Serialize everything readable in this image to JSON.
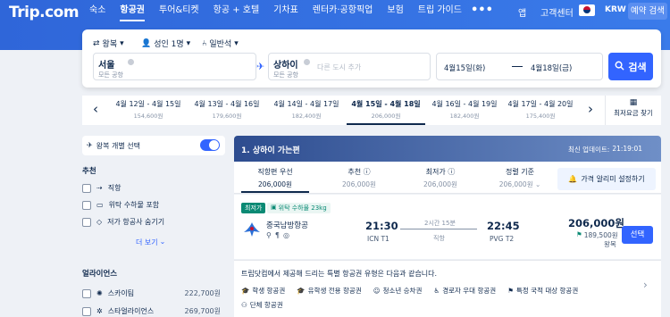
{
  "header": {
    "logo": "Trip.com",
    "nav": [
      "숙소",
      "항공권",
      "투어&티켓",
      "항공 + 호텔",
      "기차표",
      "렌터카·공항픽업",
      "보험",
      "트립 가이드"
    ],
    "more": "•••",
    "app": "앱",
    "support": "고객센터",
    "currency": "KRW",
    "check_booking": "예약 검색"
  },
  "search": {
    "trip_type": "왕복",
    "passengers": "성인 1명",
    "cabin": "일반석",
    "from_city": "서울",
    "from_sub": "모든 공항",
    "to_city": "상하이",
    "to_sub": "모든 공항",
    "add_city_placeholder": "다른 도시 추가",
    "depart_date": "4월15일(화)",
    "return_date": "4월18일(금)",
    "search_label": "검색"
  },
  "dates": [
    {
      "label": "4월 12일 - 4월 15일",
      "price": "154,600원"
    },
    {
      "label": "4월 13일 - 4월 16일",
      "price": "179,600원"
    },
    {
      "label": "4월 14일 - 4월 17일",
      "price": "182,400원"
    },
    {
      "label": "4월 15일 - 4월 18일",
      "price": "206,000원",
      "selected": true
    },
    {
      "label": "4월 16일 - 4월 19일",
      "price": "182,400원"
    },
    {
      "label": "4월 17일 - 4월 20일",
      "price": "175,400원"
    }
  ],
  "lowest_fare_finder": "최저요금 찾기",
  "sidebar": {
    "separate_roundtrip": "왕복 개별 선택",
    "recommended_title": "추천",
    "recommended": [
      "직항",
      "위탁 수하물 포함",
      "저가 항공사 숨기기"
    ],
    "more": "더 보기",
    "alliance_title": "얼라이언스",
    "alliances": [
      {
        "name": "스카이팀",
        "price": "222,700원"
      },
      {
        "name": "스타얼라이언스",
        "price": "269,700원"
      }
    ]
  },
  "results": {
    "banner_title": "1. 상하이 가는편",
    "updated_label": "최신 업데이트:",
    "updated_time": "21:19:01",
    "sort": [
      {
        "label": "직항편 우선",
        "price": "206,000원"
      },
      {
        "label": "추천",
        "price": "206,000원"
      },
      {
        "label": "최저가",
        "price": "206,000원"
      },
      {
        "label": "정렬 기준",
        "price": "206,000원"
      }
    ],
    "price_alert": "가격 알리미 설정하기",
    "flight": {
      "tag_lowest": "최저가",
      "tag_baggage": "위탁 수하물 23kg",
      "airline": "중국남방항공",
      "dep_time": "21:30",
      "dep_airport": "ICN T1",
      "duration": "2시간 15분",
      "stops": "직항",
      "arr_time": "22:45",
      "arr_airport": "PVG T2",
      "price": "206,000원",
      "sub_price": "189,500원",
      "trip_note": "왕복",
      "select_label": "선택"
    },
    "notice": {
      "text": "트립닷컴에서 제공해 드리는 특별 항공권 유형은 다음과 같습니다.",
      "tags": [
        "학생 항공권",
        "유학생 전용 항공권",
        "청소년 승차권",
        "경로자 우대 항공권",
        "특정 국적 대상 항공권",
        "단체 항공권"
      ]
    }
  }
}
